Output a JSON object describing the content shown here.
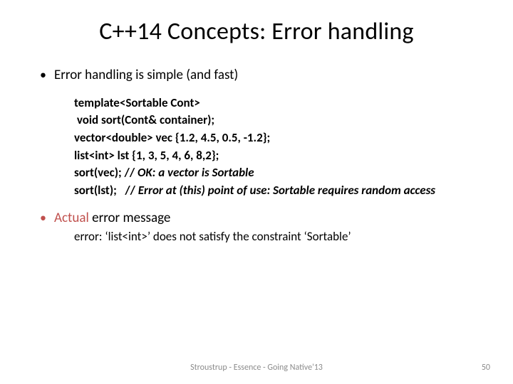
{
  "title": "C++14 Concepts: Error handling",
  "bullet1": "Error handling is simple (and fast)",
  "code": {
    "l1": "template<Sortable Cont>",
    "l2": " void sort(Cont& container);",
    "l3": "",
    "l4": "vector<double> vec {1.2, 4.5, 0.5, -1.2};",
    "l5": "list<int> lst {1, 3, 5, 4, 6, 8,2};",
    "l6": "",
    "l7a": "sort(vec); // ",
    "l7b": "OK: a vector is Sortable",
    "l8a": "sort(lst);   // ",
    "l8b": "Error at (this) point of use: Sortable requires random access"
  },
  "bullet2_accent": "Actual",
  "bullet2_rest": " error message",
  "sub2": "error: ‘list<int>’ does not satisfy the constraint ‘Sortable’",
  "footer": "Stroustrup - Essence - Going Native'13",
  "page": "50"
}
